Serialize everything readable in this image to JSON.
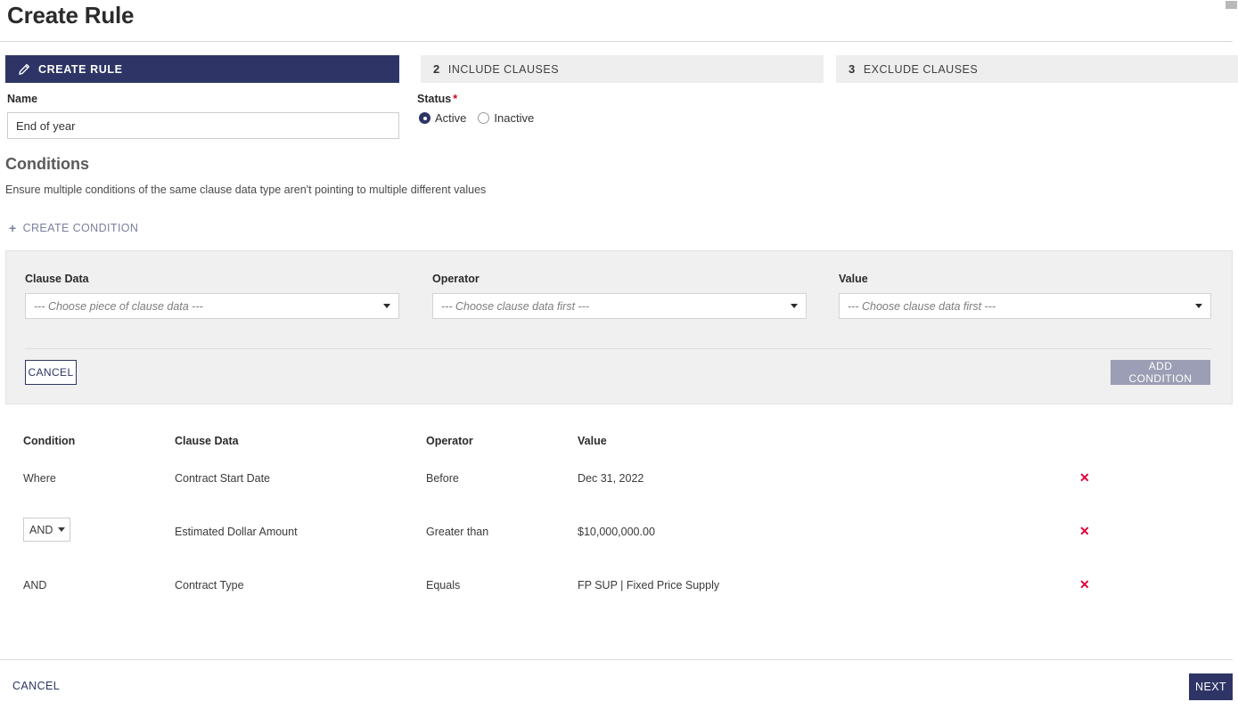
{
  "header": {
    "title": "Create Rule"
  },
  "steps": [
    {
      "num": "",
      "label": "CREATE RULE",
      "icon": "rule-edit-icon",
      "active": true
    },
    {
      "num": "2",
      "label": "INCLUDE CLAUSES",
      "active": false
    },
    {
      "num": "3",
      "label": "EXCLUDE CLAUSES",
      "active": false
    }
  ],
  "form": {
    "name_label": "Name",
    "name_value": "End of year",
    "name_placeholder": "",
    "status_label": "Status",
    "status_required_mark": "*",
    "status_options": [
      {
        "label": "Active",
        "selected": true
      },
      {
        "label": "Inactive",
        "selected": false
      }
    ]
  },
  "conditions_section": {
    "title": "Conditions",
    "subtitle": "Ensure multiple conditions of the same clause data type aren't pointing to multiple different values",
    "create_condition_label": "CREATE CONDITION",
    "plus_icon": "plus-icon"
  },
  "builder": {
    "clause_data_label": "Clause Data",
    "clause_data_placeholder": "--- Choose piece of clause data ---",
    "operator_label": "Operator",
    "operator_placeholder": "--- Choose clause data first ---",
    "value_label": "Value",
    "value_placeholder": "--- Choose clause data first ---",
    "cancel_label": "CANCEL",
    "add_condition_label": "ADD CONDITION"
  },
  "table": {
    "headers": {
      "condition": "Condition",
      "clause_data": "Clause Data",
      "operator": "Operator",
      "value": "Value"
    },
    "rows": [
      {
        "condition": "Where",
        "condition_type": "text",
        "clause_data": "Contract Start Date",
        "operator": "Before",
        "value": "Dec 31, 2022",
        "delete_icon": "delete-x-icon"
      },
      {
        "condition": "AND",
        "condition_type": "select",
        "clause_data": "Estimated Dollar Amount",
        "operator": "Greater than",
        "value": "$10,000,000.00",
        "delete_icon": "delete-x-icon"
      },
      {
        "condition": "AND",
        "condition_type": "text",
        "clause_data": "Contract Type",
        "operator": "Equals",
        "value": "FP SUP | Fixed Price Supply",
        "delete_icon": "delete-x-icon"
      }
    ]
  },
  "footer": {
    "cancel_label": "CANCEL",
    "next_label": "NEXT"
  },
  "colors": {
    "navy": "#2e3566",
    "panel_gray": "#f0f0f0",
    "tab_gray": "#eeeeee",
    "delete_red": "#e3003a",
    "required_red": "#d0021b",
    "disabled_button": "#9b9eb4"
  }
}
